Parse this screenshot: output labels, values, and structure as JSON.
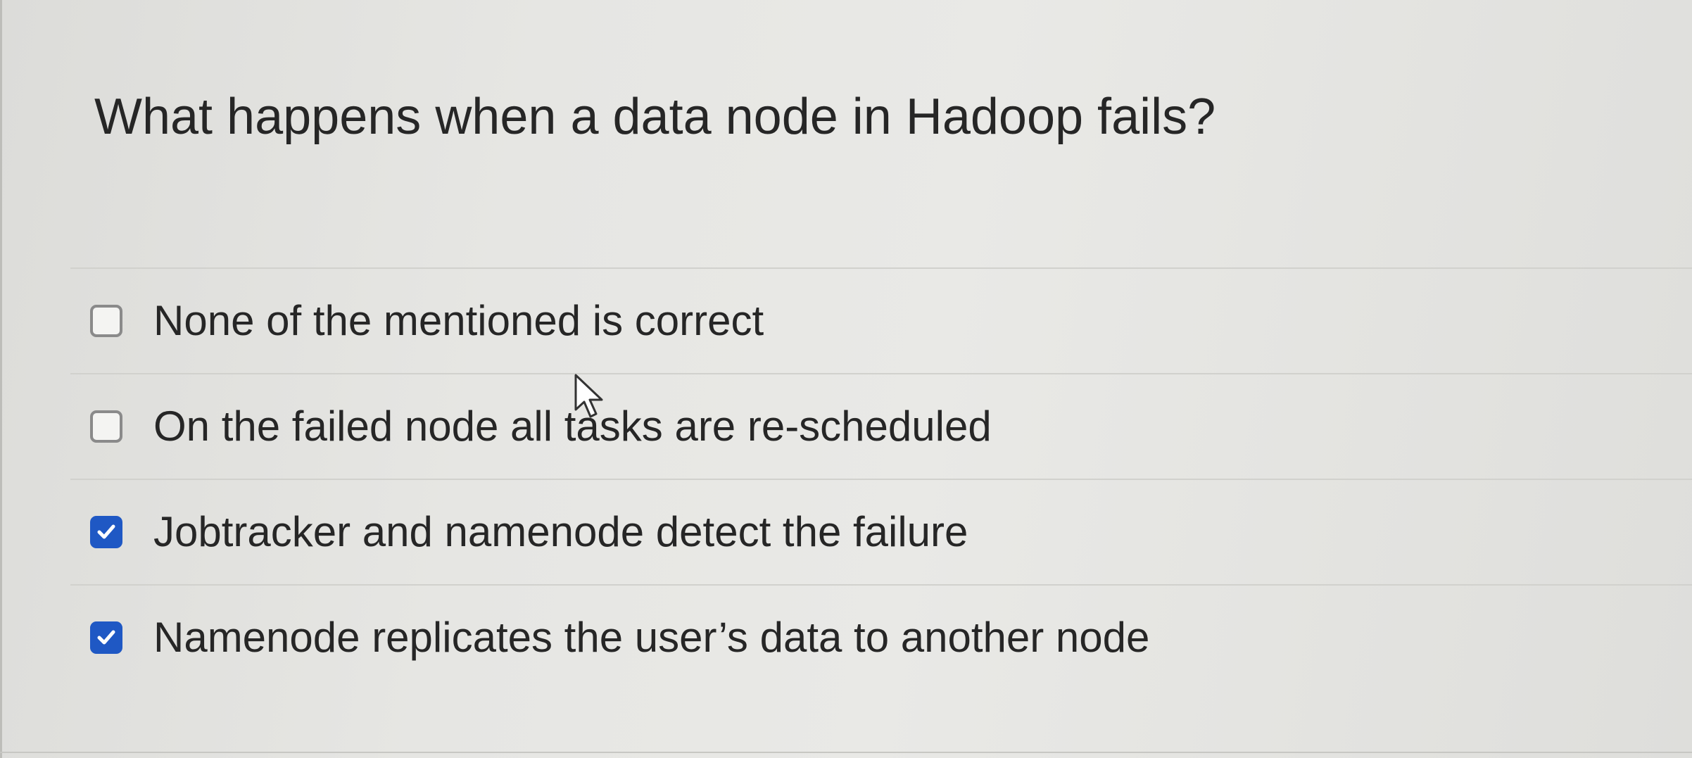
{
  "question": {
    "text": "What happens when a data node in Hadoop fails?"
  },
  "answers": [
    {
      "label": "None of the mentioned is correct",
      "checked": false
    },
    {
      "label": "On the failed node all tasks are re-scheduled",
      "checked": false
    },
    {
      "label": "Jobtracker and namenode detect the failure",
      "checked": true
    },
    {
      "label": "Namenode replicates the user’s data to another node",
      "checked": true
    }
  ],
  "colors": {
    "checkbox_checked": "#1f58c4",
    "checkbox_unchecked_border": "#8a8a8a",
    "text": "#262626"
  },
  "icons": {
    "check": "checkmark-icon",
    "cursor": "mouse-pointer-icon"
  }
}
